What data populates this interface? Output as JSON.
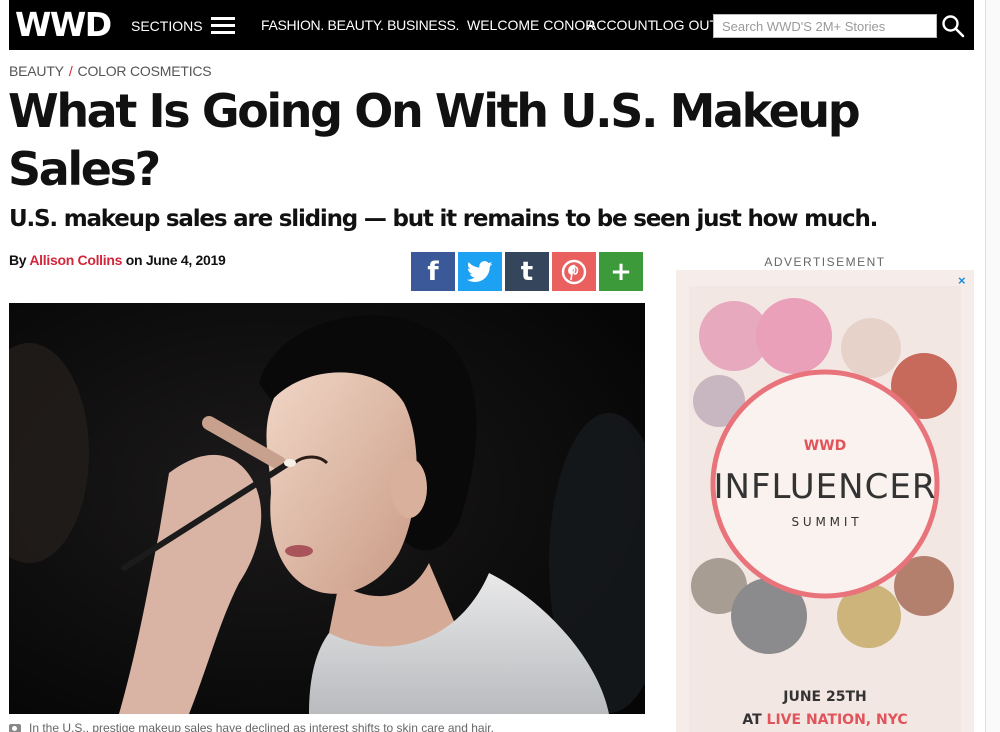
{
  "nav": {
    "logo": "WWD",
    "sections_label": "SECTIONS",
    "tagline": "FASHION. BEAUTY. BUSINESS.",
    "welcome": "WELCOME CONOR",
    "account": "ACCOUNT",
    "logout": "LOG OUT",
    "search_placeholder": "Search WWD'S 2M+ Stories"
  },
  "breadcrumb": {
    "section": "BEAUTY",
    "separator": "/",
    "subsection": "COLOR COSMETICS"
  },
  "article": {
    "title": "What Is Going On With U.S. Makeup Sales?",
    "subtitle": "U.S. makeup sales are sliding — but it remains to be seen just how much.",
    "byline_prefix": "By",
    "author": "Allison Collins",
    "date_prefix": "on",
    "date": "June 4, 2019",
    "caption": "In the U.S., prestige makeup sales have declined as interest shifts to skin care and hair."
  },
  "share": {
    "facebook": "f",
    "twitter": "twitter-icon",
    "tumblr": "t",
    "pinterest": "pinterest-icon",
    "more": "+",
    "colors": {
      "facebook": "#3b5998",
      "twitter": "#1da1f2",
      "tumblr": "#35465c",
      "pinterest": "#e9605f",
      "more": "#3d9a3b"
    }
  },
  "ad": {
    "label": "ADVERTISEMENT",
    "close": "×",
    "logo": "WWD",
    "title": "INFLUENCER",
    "subtitle": "S U M M I T",
    "date": "JUNE 25TH",
    "venue_prefix": "AT",
    "venue": "LIVE NATION, NYC",
    "accent_color": "#e0545a"
  },
  "colors": {
    "brand_red": "#d3263a",
    "nav_bg": "#000000"
  }
}
